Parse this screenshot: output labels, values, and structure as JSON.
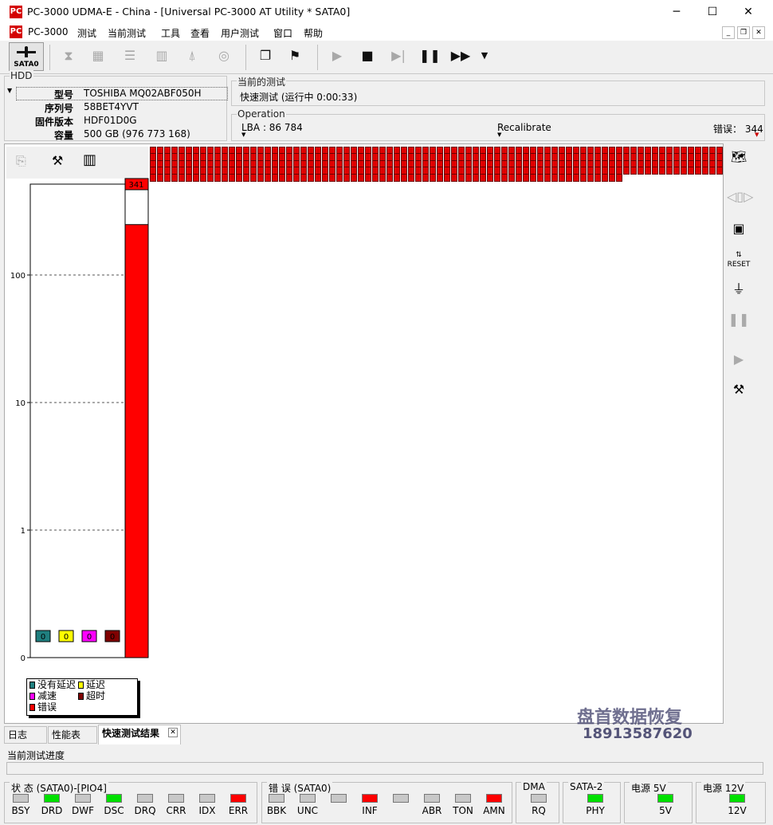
{
  "window": {
    "title": "PC-3000 UDMA-E - China - [Universal PC-3000 AT Utility * SATA0]",
    "logo": "PC",
    "minimize": "─",
    "maximize": "☐",
    "close": "✕"
  },
  "menu": {
    "items": [
      "PC-3000",
      "测试",
      "当前测试",
      "工具",
      "查看",
      "用户测试",
      "窗口",
      "帮助"
    ],
    "mdi_min": "_",
    "mdi_restore": "❐",
    "mdi_close": "✕"
  },
  "toolbar": {
    "sata_label": "SATA0"
  },
  "hdd": {
    "title": "HDD",
    "rows": [
      {
        "key": "型号",
        "value": "TOSHIBA MQ02ABF050H"
      },
      {
        "key": "序列号",
        "value": "58BET4YVT"
      },
      {
        "key": "固件版本",
        "value": "HDF01D0G"
      },
      {
        "key": "容量",
        "value": "500 GB (976 773 168)"
      }
    ]
  },
  "current_test": {
    "title": "当前的测试",
    "value": "快速测试 (运行中 0:00:33)"
  },
  "operation": {
    "title": "Operation",
    "lba": "LBA : 86 784",
    "recal": "Recalibrate",
    "errors": "错误： 344"
  },
  "chart_data": {
    "type": "bar",
    "yscale": "log",
    "ylim": [
      0,
      341
    ],
    "yticks": [
      "0",
      "1",
      "10",
      "100"
    ],
    "categories": [
      "没有延迟",
      "延迟",
      "减速",
      "超时",
      "错误"
    ],
    "values": [
      0,
      0,
      0,
      0,
      341
    ],
    "colors": [
      "#1f7f7f",
      "#ffff00",
      "#ff00ff",
      "#800000",
      "#ff0000"
    ],
    "value_labels": [
      "0",
      "0",
      "0",
      "0",
      "341"
    ],
    "legend": [
      {
        "label": "没有延迟",
        "color": "#1f7f7f"
      },
      {
        "label": "延迟",
        "color": "#ffff00"
      },
      {
        "label": "减速",
        "color": "#ff00ff"
      },
      {
        "label": "超时",
        "color": "#800000"
      },
      {
        "label": "错误",
        "color": "#ff0000"
      }
    ]
  },
  "error_grid": {
    "rows": [
      80,
      80,
      80,
      80,
      66
    ],
    "color": "#e00000"
  },
  "tabs": [
    "日志",
    "性能表",
    "快速测试结果"
  ],
  "progress": {
    "label": "当前测试进度"
  },
  "status": {
    "sata_state": {
      "title": "状 态 (SATA0)-[PIO4]",
      "leds": [
        {
          "label": "BSY",
          "state": "off"
        },
        {
          "label": "DRD",
          "state": "green"
        },
        {
          "label": "DWF",
          "state": "off"
        },
        {
          "label": "DSC",
          "state": "green"
        },
        {
          "label": "DRQ",
          "state": "off"
        },
        {
          "label": "CRR",
          "state": "off"
        },
        {
          "label": "IDX",
          "state": "off"
        },
        {
          "label": "ERR",
          "state": "red"
        }
      ]
    },
    "errors": {
      "title": "错 误 (SATA0)",
      "leds": [
        {
          "label": "BBK",
          "state": "off"
        },
        {
          "label": "UNC",
          "state": "off"
        },
        {
          "label": "",
          "state": "off"
        },
        {
          "label": "INF",
          "state": "red"
        },
        {
          "label": "",
          "state": "off"
        },
        {
          "label": "ABR",
          "state": "off"
        },
        {
          "label": "TON",
          "state": "off"
        },
        {
          "label": "AMN",
          "state": "red"
        }
      ]
    },
    "dma": {
      "title": "DMA",
      "leds": [
        {
          "label": "RQ",
          "state": "off"
        }
      ]
    },
    "sata2": {
      "title": "SATA-2",
      "leds": [
        {
          "label": "PHY",
          "state": "green"
        }
      ]
    },
    "p5": {
      "title": "电源 5V",
      "leds": [
        {
          "label": "5V",
          "state": "green"
        }
      ]
    },
    "p12": {
      "title": "电源 12V",
      "leds": [
        {
          "label": "12V",
          "state": "green"
        }
      ]
    }
  },
  "watermark": {
    "line1": "盘首数据恢复",
    "line2": "18913587620"
  }
}
